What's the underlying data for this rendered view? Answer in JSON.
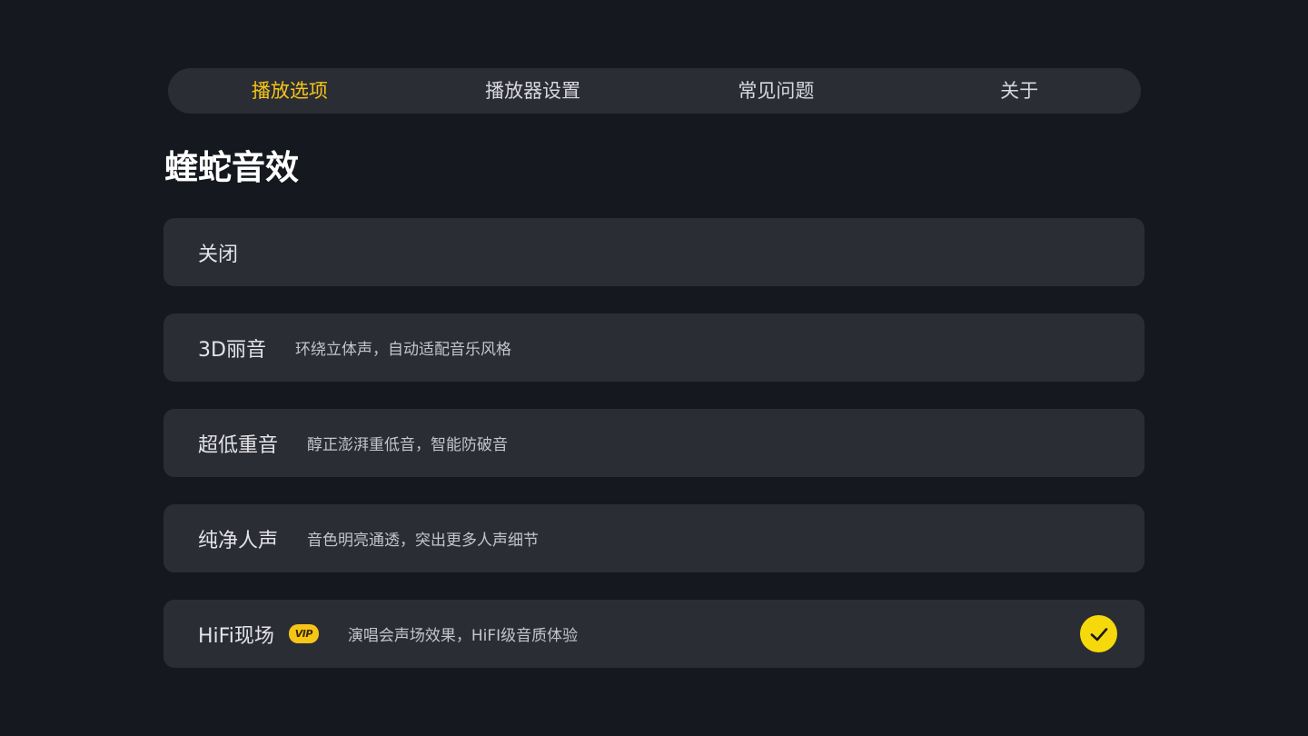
{
  "tabs": [
    {
      "label": "播放选项",
      "active": true
    },
    {
      "label": "播放器设置",
      "active": false
    },
    {
      "label": "常见问题",
      "active": false
    },
    {
      "label": "关于",
      "active": false
    }
  ],
  "section_title": "蝰蛇音效",
  "options": [
    {
      "name": "关闭",
      "description": ""
    },
    {
      "name": "3D丽音",
      "description": "环绕立体声，自动适配音乐风格"
    },
    {
      "name": "超低重音",
      "description": "醇正澎湃重低音，智能防破音"
    },
    {
      "name": "纯净人声",
      "description": "音色明亮通透，突出更多人声细节"
    },
    {
      "name": "HiFi现场",
      "badge": "VIP",
      "description": "演唱会声场效果，HiFI级音质体验",
      "selected": true
    }
  ],
  "colors": {
    "background": "#16181f",
    "card": "#2b2d35",
    "accent": "#f5c518"
  },
  "icons": {
    "selected": "checkmark-circle-icon",
    "vip": "vip-badge-icon"
  }
}
